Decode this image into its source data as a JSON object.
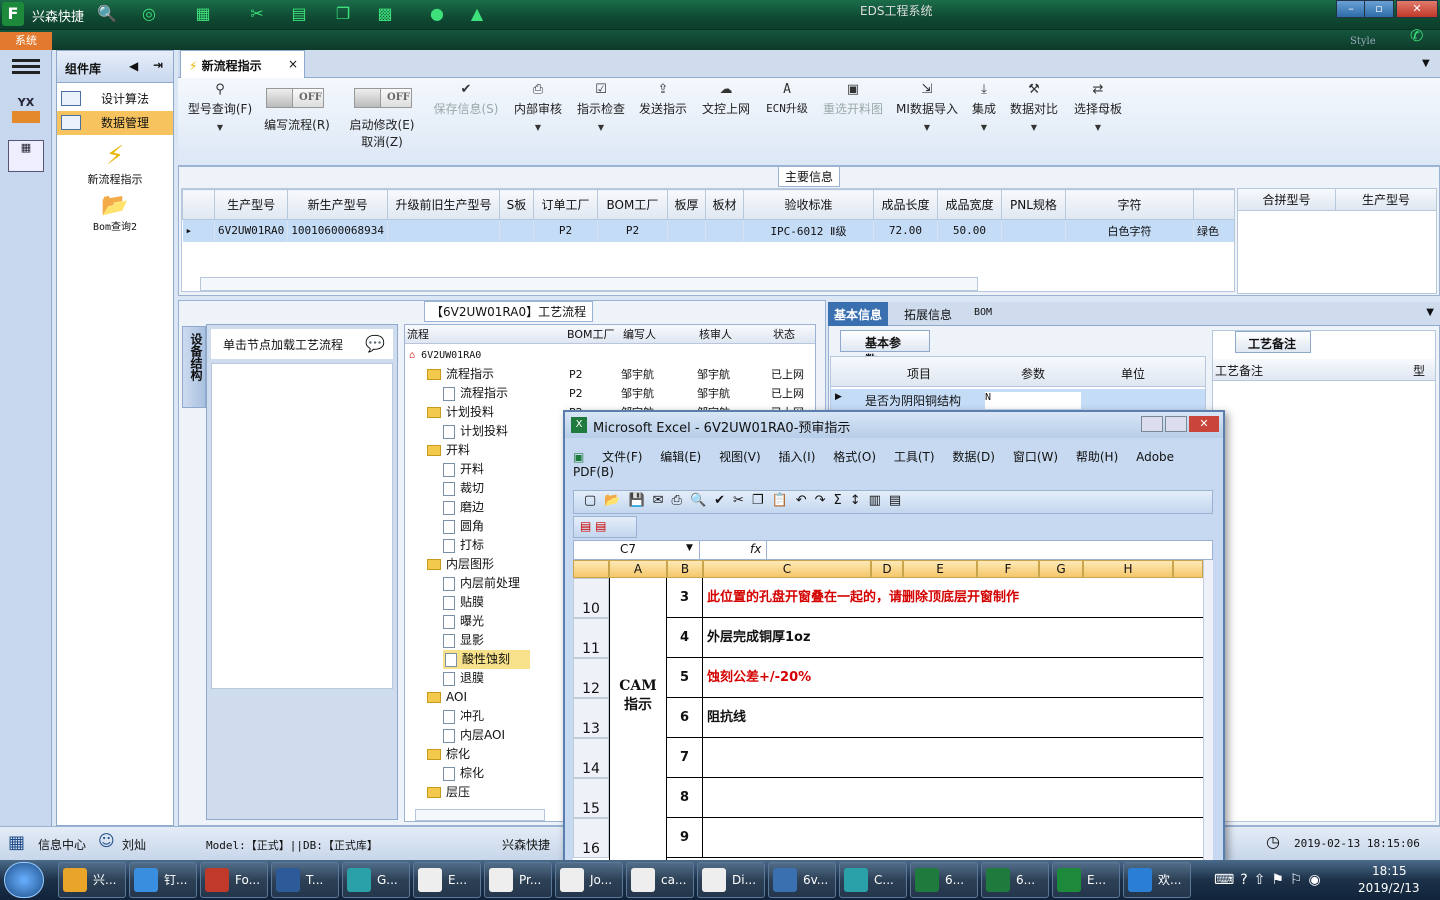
{
  "app": {
    "title": "兴森快捷",
    "window_title": "EDS工程系统",
    "system_label": "系统",
    "style_label": "Style"
  },
  "sidebar": {
    "component_lib": "组件库",
    "items": [
      {
        "label": "设计算法"
      },
      {
        "label": "数据管理"
      }
    ],
    "tools": [
      {
        "label": "新流程指示"
      },
      {
        "label": "Bom查询2"
      }
    ],
    "yx_label": "YX"
  },
  "tab": {
    "label": "新流程指示",
    "close": "×"
  },
  "ribbon": {
    "buttons": [
      {
        "label": "型号查询(F)",
        "icon": "search-icon"
      },
      {
        "label": "编写流程(R)"
      },
      {
        "label": "启动修改(E)",
        "sub": "取消(Z)"
      },
      {
        "label": "保存信息(S)"
      },
      {
        "label": "内部审核"
      },
      {
        "label": "指示检查"
      },
      {
        "label": "发送指示"
      },
      {
        "label": "文控上网"
      },
      {
        "label": "ECN升级"
      },
      {
        "label": "重选开料图"
      },
      {
        "label": "MI数据导入"
      },
      {
        "label": "集成"
      },
      {
        "label": "数据对比"
      },
      {
        "label": "选择母板"
      }
    ],
    "toggle_off": "OFF"
  },
  "main_info": {
    "title": "主要信息",
    "columns": [
      "生产型号",
      "新生产型号",
      "升级前旧生产型号",
      "S板",
      "订单工厂",
      "BOM工厂",
      "板厚",
      "板材",
      "验收标准",
      "成品长度",
      "成品宽度",
      "PNL规格",
      "字符"
    ],
    "row": [
      "6V2UW01RA0",
      "10010600068934",
      "",
      "",
      "P2",
      "P2",
      "",
      "",
      "IPC-6012 Ⅱ级",
      "72.00",
      "50.00",
      "",
      "白色字符",
      "绿色"
    ],
    "right_columns": [
      "合拼型号",
      "生产型号"
    ]
  },
  "process": {
    "title": "【6V2UW01RA0】工艺流程",
    "side_tab": "设备结构",
    "hint": "单击节点加载工艺流程",
    "columns": [
      "流程",
      "BOM工厂",
      "编写人",
      "核审人",
      "状态"
    ],
    "root": "6V2UW01RA0",
    "tree": [
      {
        "label": "流程指示",
        "level": 1,
        "folder": true,
        "bom": "P2",
        "writer": "邹宇航",
        "reviewer": "邹宇航",
        "status": "已上网"
      },
      {
        "label": "流程指示",
        "level": 2,
        "bom": "P2",
        "writer": "邹宇航",
        "reviewer": "邹宇航",
        "status": "已上网"
      },
      {
        "label": "计划投料",
        "level": 1,
        "folder": true,
        "bom": "P2",
        "writer": "邹宇航",
        "reviewer": "邹宇航",
        "status": "已上网"
      },
      {
        "label": "计划投料",
        "level": 2
      },
      {
        "label": "开料",
        "level": 1,
        "folder": true
      },
      {
        "label": "开料",
        "level": 2
      },
      {
        "label": "裁切",
        "level": 2
      },
      {
        "label": "磨边",
        "level": 2
      },
      {
        "label": "圆角",
        "level": 2
      },
      {
        "label": "打标",
        "level": 2
      },
      {
        "label": "内层图形",
        "level": 1,
        "folder": true
      },
      {
        "label": "内层前处理",
        "level": 2
      },
      {
        "label": "贴膜",
        "level": 2
      },
      {
        "label": "曝光",
        "level": 2
      },
      {
        "label": "显影",
        "level": 2
      },
      {
        "label": "酸性蚀刻",
        "level": 2,
        "selected": true
      },
      {
        "label": "退膜",
        "level": 2
      },
      {
        "label": "AOI",
        "level": 1,
        "folder": true
      },
      {
        "label": "冲孔",
        "level": 2
      },
      {
        "label": "内层AOI",
        "level": 2
      },
      {
        "label": "棕化",
        "level": 1,
        "folder": true
      },
      {
        "label": "棕化",
        "level": 2
      },
      {
        "label": "层压",
        "level": 1,
        "folder": true
      }
    ]
  },
  "right_panel": {
    "tabs": [
      "基本信息",
      "拓展信息",
      "BOM"
    ],
    "sub_tab": "基本参数",
    "columns": [
      "项目",
      "参数",
      "单位"
    ],
    "row": {
      "item": "是否为阴阳铜结构",
      "param": "N",
      "unit": ""
    },
    "notes_tab": "工艺备注",
    "notes_header": "工艺备注",
    "notes_col": "型"
  },
  "excel": {
    "title": "Microsoft Excel - 6V2UW01RA0-预审指示",
    "menu": [
      "文件(F)",
      "编辑(E)",
      "视图(V)",
      "插入(I)",
      "格式(O)",
      "工具(T)",
      "数据(D)",
      "窗口(W)",
      "帮助(H)",
      "Adobe PDF(B)"
    ],
    "name_box": "C7",
    "fx": "fx",
    "columns": [
      "A",
      "B",
      "C",
      "D",
      "E",
      "F",
      "G",
      "H"
    ],
    "rows": [
      {
        "num": "10",
        "b": "3",
        "c": "此位置的孔盘开窗叠在一起的，请删除顶底层开窗制作",
        "red": true
      },
      {
        "num": "11",
        "b": "4",
        "c": "外层完成铜厚1oz",
        "red": false
      },
      {
        "num": "12",
        "b": "5",
        "c": "蚀刻公差+/-20%",
        "red": true
      },
      {
        "num": "13",
        "b": "6",
        "c": "阻抗线",
        "red": false
      },
      {
        "num": "14",
        "b": "7",
        "c": "",
        "red": false
      },
      {
        "num": "15",
        "b": "8",
        "c": "",
        "red": false
      },
      {
        "num": "16",
        "b": "9",
        "c": "",
        "red": false
      }
    ],
    "merged_a": "CAM\n指示"
  },
  "statusbar": {
    "info_center": "信息中心",
    "user": "刘灿",
    "model": "Model:【正式】||DB:【正式库】",
    "company": "兴森快捷",
    "datetime": "2019-02-13 18:15:06"
  },
  "taskbar": {
    "items": [
      {
        "label": "兴..."
      },
      {
        "label": "钉..."
      },
      {
        "label": "Fo..."
      },
      {
        "label": "T..."
      },
      {
        "label": "G..."
      },
      {
        "label": "E..."
      },
      {
        "label": "Pr..."
      },
      {
        "label": "Jo..."
      },
      {
        "label": "ca..."
      },
      {
        "label": "Di..."
      },
      {
        "label": "6v..."
      },
      {
        "label": "C..."
      },
      {
        "label": "6..."
      },
      {
        "label": "6..."
      },
      {
        "label": "E..."
      },
      {
        "label": "欢..."
      }
    ],
    "time": "18:15",
    "date": "2019/2/13"
  },
  "colors": {
    "accent": "#f7c35f",
    "title_bg": "#0f4a33",
    "red_text": "#d40000"
  }
}
